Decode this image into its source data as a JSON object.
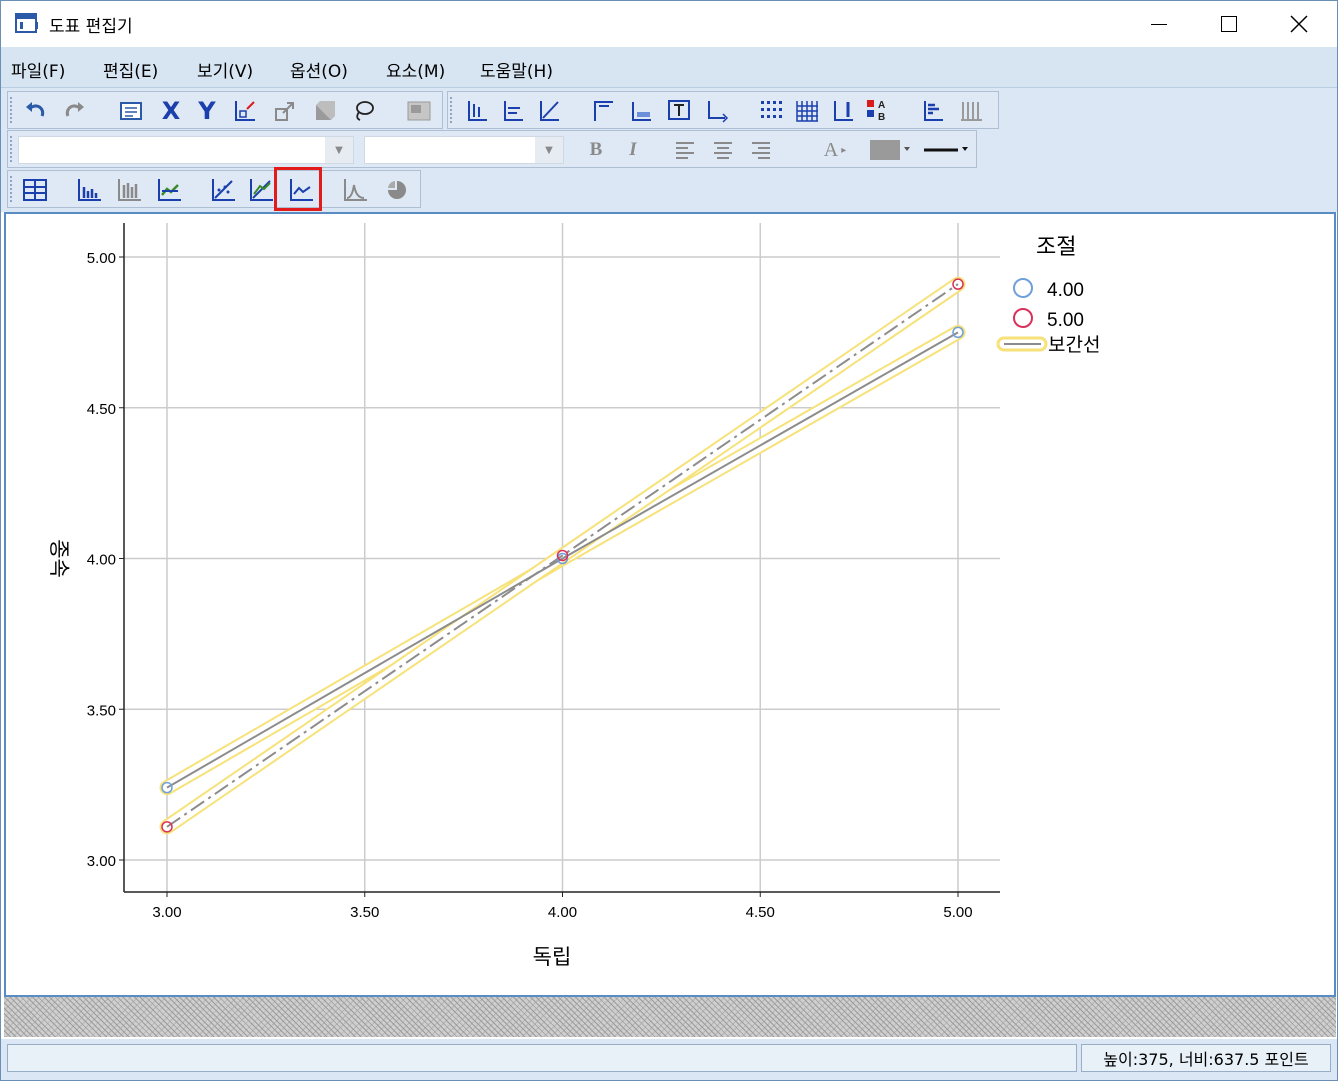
{
  "window": {
    "title": "도표 편집기"
  },
  "menu": [
    {
      "label": "파일(F)"
    },
    {
      "label": "편집(E)"
    },
    {
      "label": "보기(V)"
    },
    {
      "label": "옵션(O)"
    },
    {
      "label": "요소(M)"
    },
    {
      "label": "도움말(H)"
    }
  ],
  "toolbar": {
    "font_name": "",
    "font_size": "",
    "bold_label": "B",
    "italic_label": "I",
    "text_color_label": "A",
    "x_axis_label": "X",
    "y_axis_label": "Y",
    "selected_tool": "add-interpolation-line-icon"
  },
  "status": {
    "size_text": "높이:375, 너비:637.5 포인트"
  },
  "colors": {
    "accent": "#d7e4f2",
    "highlight": "#e21b1b",
    "selection": "#f7e27a",
    "series_4": "#6fa0d8",
    "series_5": "#d9305a"
  },
  "chart_data": {
    "type": "line",
    "xlabel": "독립",
    "ylabel": "종속",
    "xlim": [
      3.0,
      5.0
    ],
    "ylim": [
      3.0,
      5.0
    ],
    "x_ticks": [
      "3.00",
      "3.50",
      "4.00",
      "4.50",
      "5.00"
    ],
    "y_ticks": [
      "3.00",
      "3.50",
      "4.00",
      "4.50",
      "5.00"
    ],
    "grid": true,
    "legend_title": "조절",
    "legend_position": "top-right",
    "legend_line_label": "보간선",
    "x": [
      3.0,
      4.0,
      5.0
    ],
    "series": [
      {
        "name": "4.00",
        "values": [
          3.24,
          4.0,
          4.75
        ]
      },
      {
        "name": "5.00",
        "values": [
          3.11,
          4.01,
          4.91
        ]
      }
    ]
  }
}
